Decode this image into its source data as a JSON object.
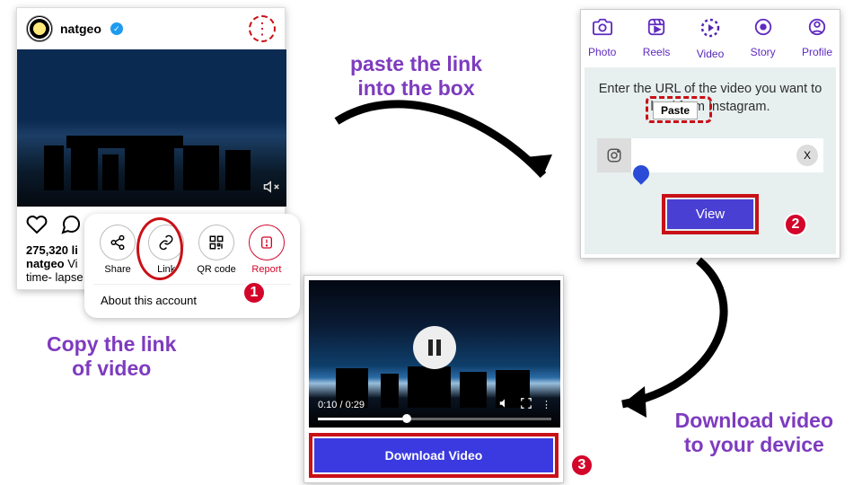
{
  "caption1": "Copy the link\nof video",
  "caption2": "paste the link\ninto the box",
  "caption3": "Download video\nto your device",
  "panel1": {
    "username": "natgeo",
    "likes": "275,320 li",
    "caption_user": "natgeo",
    "caption_text": "Vi",
    "caption_sub": "time- lapse",
    "sheet": {
      "share": "Share",
      "link": "Link",
      "qr": "QR code",
      "report": "Report",
      "about": "About this account"
    }
  },
  "panel2": {
    "tabs": {
      "photo": "Photo",
      "reels": "Reels",
      "video": "Video",
      "story": "Story",
      "profile": "Profile"
    },
    "message_a": "Enter the URL of the video you want to",
    "message_b": "load from Instagram.",
    "paste": "Paste",
    "clear": "X",
    "view": "View"
  },
  "panel3": {
    "time": "0:10 / 0:29",
    "download": "Download Video"
  },
  "badges": {
    "b1": "1",
    "b2": "2",
    "b3": "3"
  }
}
